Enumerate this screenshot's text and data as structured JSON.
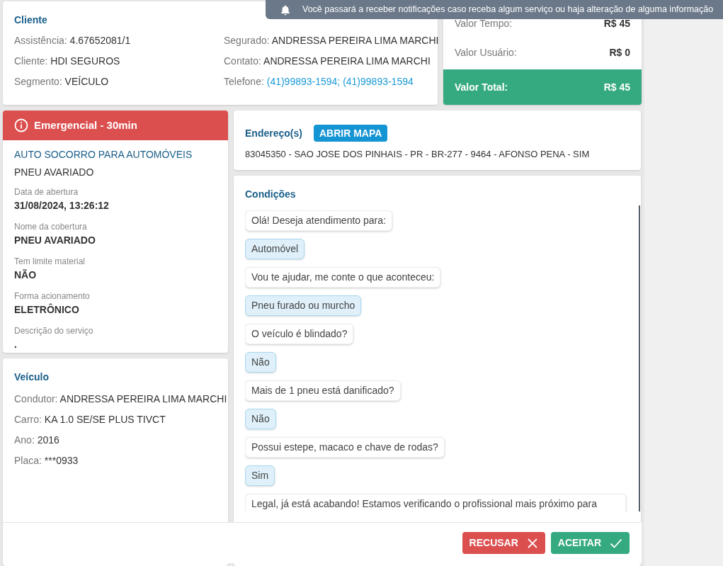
{
  "toast": {
    "text": "Você passará a receber notificações caso receba algum serviço ou haja alteração de alguma informação"
  },
  "client": {
    "title": "Cliente",
    "fields": [
      {
        "label": "Assistência:",
        "value": "4.67652081/1",
        "kind": "text"
      },
      {
        "label": "Segurado:",
        "value": "ANDRESSA PEREIRA LIMA MARCHI",
        "kind": "text"
      },
      {
        "label": "Cliente:",
        "value": "HDI SEGUROS",
        "kind": "text"
      },
      {
        "label": "Contato:",
        "value": "ANDRESSA PEREIRA LIMA MARCHI",
        "kind": "text"
      },
      {
        "label": "Segmento:",
        "value": "VEÍCULO",
        "kind": "text"
      },
      {
        "label": "Telefone:",
        "value": "(41)99893-1594; (41)99893-1594",
        "kind": "link"
      }
    ]
  },
  "values": [
    {
      "label": "Valor Tempo:",
      "value": "R$ 45",
      "total": false
    },
    {
      "label": "Valor Usuário:",
      "value": "R$ 0",
      "total": false
    },
    {
      "label": "Valor Total:",
      "value": "R$ 45",
      "total": true
    }
  ],
  "service": {
    "priority": "Emergencial - 30min",
    "title": "AUTO SOCORRO PARA AUTOMÓVEIS",
    "subtitle": "PNEU AVARIADO",
    "fields": [
      {
        "label": "Data de abertura",
        "value": "31/08/2024, 13:26:12"
      },
      {
        "label": "Nome da cobertura",
        "value": "PNEU AVARIADO"
      },
      {
        "label": "Tem limite material",
        "value": "NÃO"
      },
      {
        "label": "Forma acionamento",
        "value": "ELETRÔNICO"
      },
      {
        "label": "Descrição do serviço",
        "value": "."
      }
    ]
  },
  "vehicle": {
    "title": "Veículo",
    "fields": [
      {
        "label": "Condutor:",
        "value": "ANDRESSA PEREIRA LIMA MARCHI"
      },
      {
        "label": "Carro:",
        "value": "KA 1.0 SE/SE PLUS TIVCT"
      },
      {
        "label": "Ano:",
        "value": "2016"
      },
      {
        "label": "Placa:",
        "value": "***0933"
      }
    ]
  },
  "address": {
    "title": "Endereço(s)",
    "button": "ABRIR MAPA",
    "text": "83045350 - SAO JOSE DOS PINHAIS - PR - BR-277 - 9464 - AFONSO PENA - SIM"
  },
  "conditions": {
    "title": "Condições",
    "messages": [
      {
        "kind": "bot",
        "text": "Olá! Deseja atendimento para:"
      },
      {
        "kind": "user",
        "text": "Automóvel"
      },
      {
        "kind": "bot",
        "text": "Vou te ajudar, me conte o que aconteceu:"
      },
      {
        "kind": "user",
        "text": "Pneu furado ou murcho"
      },
      {
        "kind": "bot",
        "text": "O veículo é blindado?"
      },
      {
        "kind": "user",
        "text": "Não"
      },
      {
        "kind": "bot",
        "text": "Mais de 1 pneu está danificado?"
      },
      {
        "kind": "user",
        "text": "Não"
      },
      {
        "kind": "bot",
        "text": "Possui estepe, macaco e chave de rodas?"
      },
      {
        "kind": "user",
        "text": "Sim"
      },
      {
        "kind": "bot",
        "text": "Legal, já está acabando! Estamos verificando o profissional mais próximo para"
      }
    ]
  },
  "actions": [
    {
      "kind": "refuse",
      "label": "RECUSAR"
    },
    {
      "kind": "accept",
      "label": "ACEITAR"
    }
  ]
}
